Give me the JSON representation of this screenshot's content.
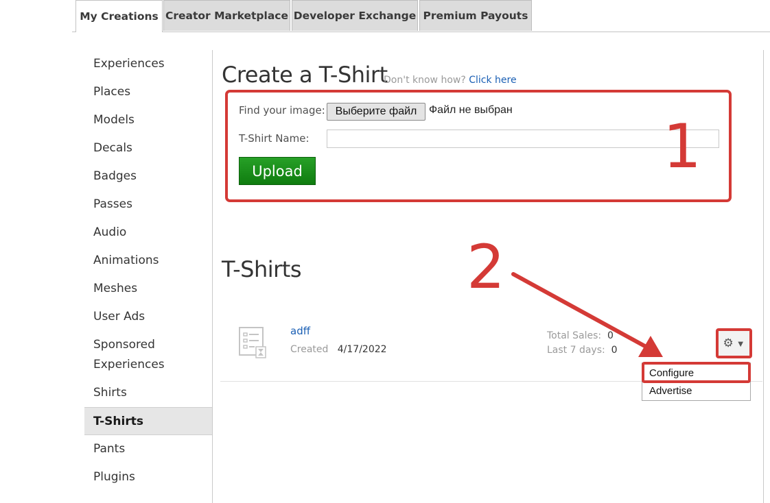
{
  "tabs": [
    {
      "label": "My Creations",
      "active": true
    },
    {
      "label": "Creator Marketplace",
      "active": false
    },
    {
      "label": "Developer Exchange",
      "active": false
    },
    {
      "label": "Premium Payouts",
      "active": false
    }
  ],
  "sidebar": {
    "items": [
      {
        "label": "Experiences"
      },
      {
        "label": "Places"
      },
      {
        "label": "Models"
      },
      {
        "label": "Decals"
      },
      {
        "label": "Badges"
      },
      {
        "label": "Passes"
      },
      {
        "label": "Audio"
      },
      {
        "label": "Animations"
      },
      {
        "label": "Meshes"
      },
      {
        "label": "User Ads"
      },
      {
        "label": "Sponsored",
        "label2": "Experiences"
      },
      {
        "label": "Shirts"
      },
      {
        "label": "T-Shirts",
        "active": true
      },
      {
        "label": "Pants"
      },
      {
        "label": "Plugins"
      }
    ]
  },
  "create": {
    "title": "Create a T-Shirt",
    "help_text": "Don't know how?",
    "help_link": "Click here",
    "image_label": "Find your image:",
    "file_button": "Выберите файл",
    "file_status": "Файл не выбран",
    "name_label": "T-Shirt Name:",
    "name_value": "",
    "upload_button": "Upload"
  },
  "annotations": {
    "step1": "1",
    "step2": "2",
    "color": "#d43a36"
  },
  "list": {
    "title": "T-Shirts",
    "items": [
      {
        "name": "adff",
        "created_label": "Created",
        "created_date": "4/17/2022",
        "total_sales_label": "Total Sales:",
        "total_sales": "0",
        "last7_label": "Last 7 days:",
        "last7": "0"
      }
    ]
  },
  "gear_menu": {
    "icon": "gear-icon",
    "caret": "▼",
    "items": [
      "Configure",
      "Advertise"
    ]
  },
  "colors": {
    "link": "#1a5fb4",
    "upload_green": "#1a8c1a",
    "active_sidebar_bg": "#e6e6e6"
  }
}
